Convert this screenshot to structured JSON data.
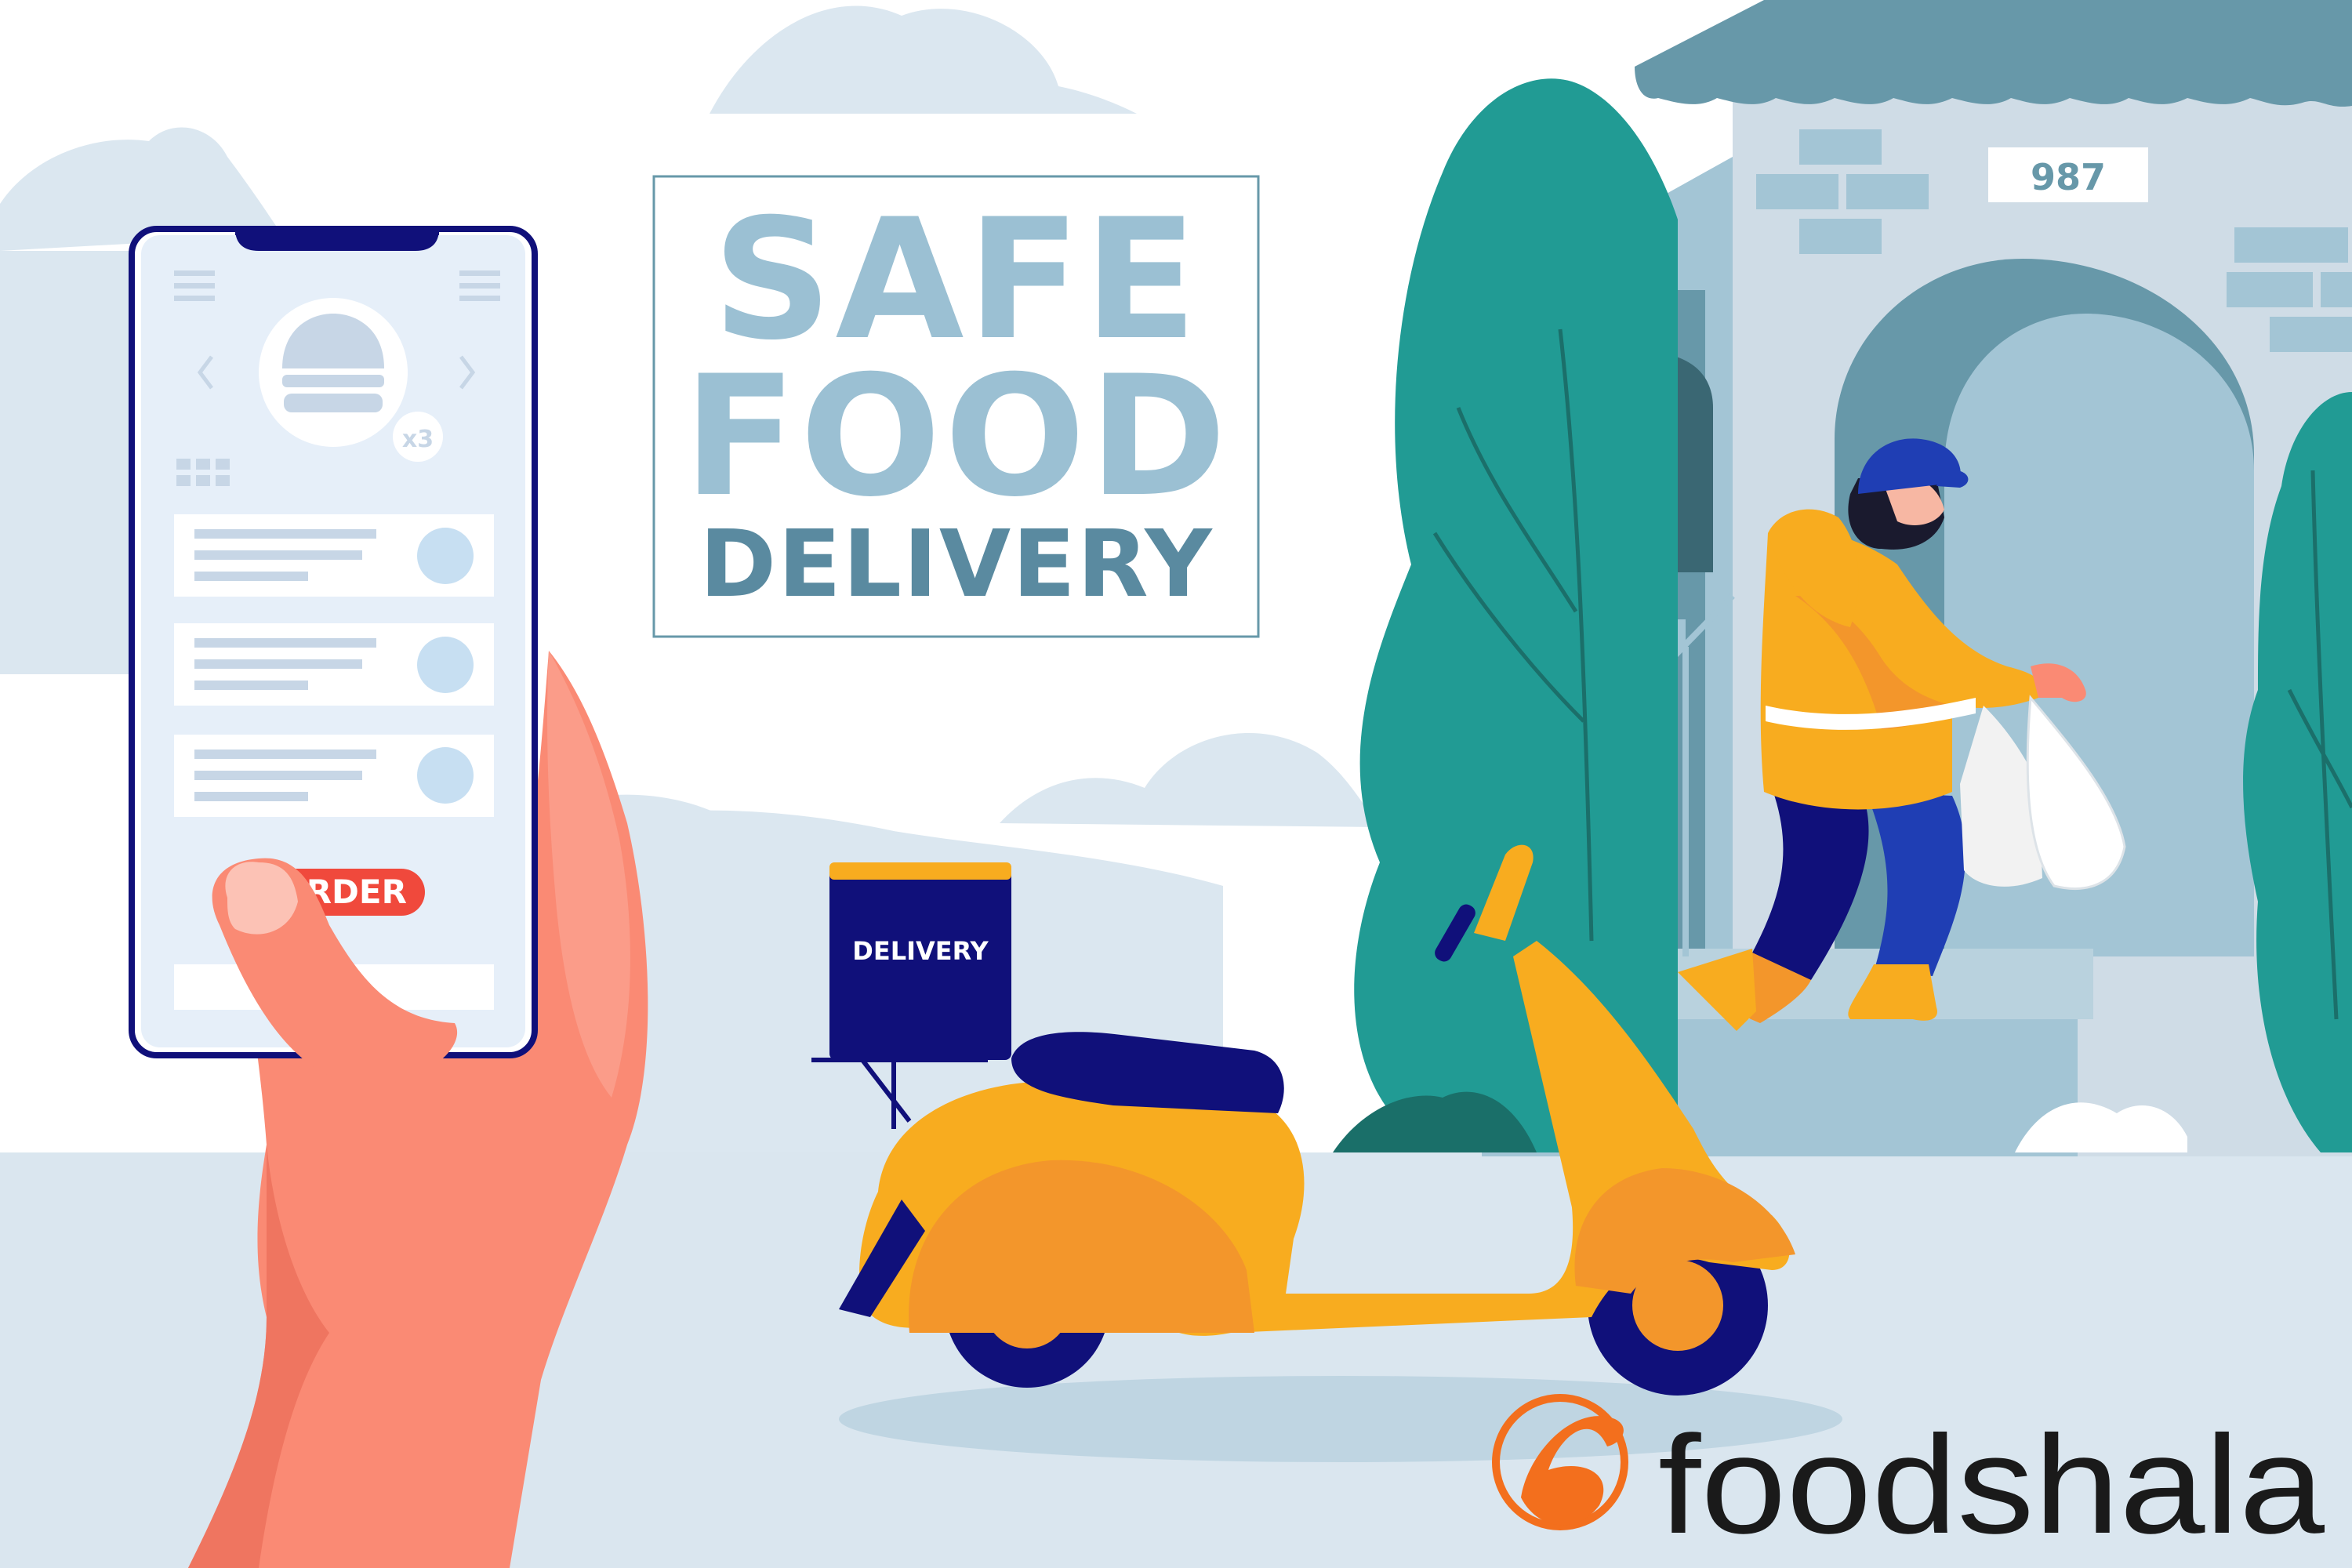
{
  "headline": {
    "line1": "SAFE",
    "line2": "FOOD",
    "line3": "DELIVERY"
  },
  "phone": {
    "order_button_label": "ORDER",
    "quantity_badge": "x3"
  },
  "delivery_box_label": "DELIVERY",
  "house_number": "987",
  "brand": {
    "name": "foodshala"
  },
  "colors": {
    "sky": "#ffffff",
    "cloud": "#dbe7f0",
    "ground": "#dae6ef",
    "headline_light": "#9bc0d3",
    "headline_dark": "#5a8aa0",
    "scooter_yellow": "#f8ac1f",
    "scooter_orange": "#f3962b",
    "navy": "#10107a",
    "tree_teal": "#219b94",
    "house_blue": "#6798a9",
    "skin": "#fa8a74",
    "order_red": "#f0493c",
    "brand_orange": "#f36f1d"
  }
}
